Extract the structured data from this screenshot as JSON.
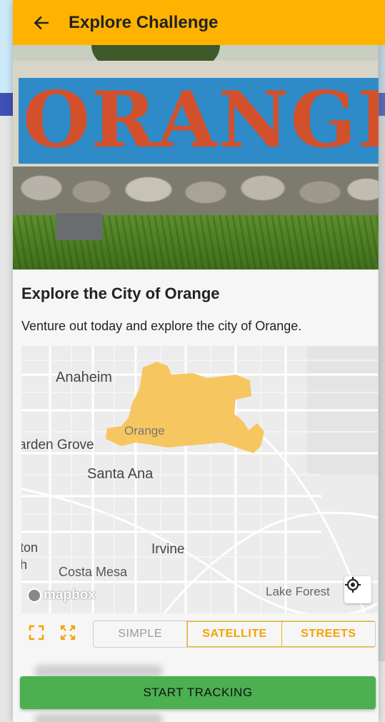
{
  "appbar": {
    "title": "Explore Challenge",
    "back_icon": "arrow-left-icon"
  },
  "hero": {
    "sign_text": "ORANGE"
  },
  "challenge": {
    "title": "Explore the City of Orange",
    "description": "Venture out today and explore the city of Orange."
  },
  "map": {
    "labels": {
      "anaheim": "Anaheim",
      "orange": "Orange",
      "garden_grove": "arden Grove",
      "santa_ana": "Santa Ana",
      "ton": "ton",
      "h": "h",
      "irvine": "Irvine",
      "costa_mesa": "Costa Mesa",
      "lake_forest": "Lake Forest"
    },
    "logo": "mapbox",
    "highlight_color": "#f7c45a",
    "locate_icon": "crosshair-target-icon"
  },
  "controls": {
    "expand_icon": "fullscreen-corners-icon",
    "fit_icon": "fit-bounds-arrows-icon",
    "styles": [
      "SIMPLE",
      "SATELLITE",
      "STREETS"
    ],
    "selected_style": "SATELLITE"
  },
  "actions": {
    "start_label": "START TRACKING"
  },
  "colors": {
    "appbar": "#ffb300",
    "accent": "#f5a300",
    "start_button": "#4caf50"
  }
}
